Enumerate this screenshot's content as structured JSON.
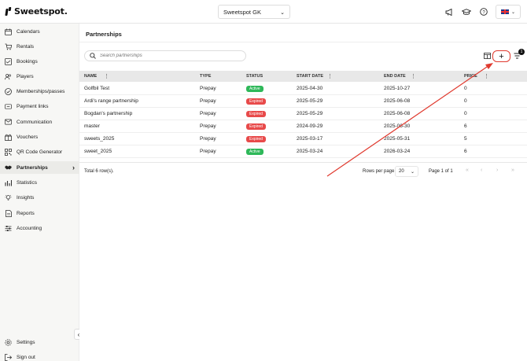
{
  "app": {
    "logo_text": "Sweetspot."
  },
  "header": {
    "club_select": "Sweetspot GK",
    "icons": [
      "megaphone-icon",
      "graduation-cap-icon",
      "help-icon"
    ],
    "language": "english"
  },
  "sidebar": {
    "items": [
      {
        "label": "Calendars",
        "icon": "calendar-icon"
      },
      {
        "label": "Rentals",
        "icon": "cart-icon"
      },
      {
        "label": "Bookings",
        "icon": "bookings-icon"
      },
      {
        "label": "Players",
        "icon": "players-icon"
      },
      {
        "label": "Memberships/passes",
        "icon": "check-circle-icon"
      },
      {
        "label": "Payment links",
        "icon": "link-icon"
      },
      {
        "label": "Communication",
        "icon": "mail-icon"
      },
      {
        "label": "Vouchers",
        "icon": "gift-icon"
      },
      {
        "label": "QR Code Generator",
        "icon": "qr-icon"
      },
      {
        "label": "Partnerships",
        "icon": "handshake-icon",
        "active": true
      },
      {
        "label": "Statistics",
        "icon": "chart-icon"
      },
      {
        "label": "Insights",
        "icon": "lightbulb-icon"
      },
      {
        "label": "Reports",
        "icon": "report-icon"
      },
      {
        "label": "Accounting",
        "icon": "sliders-icon"
      }
    ],
    "bottom": [
      {
        "label": "Settings",
        "icon": "gear-icon"
      },
      {
        "label": "Sign out",
        "icon": "sign-out-icon"
      }
    ]
  },
  "main": {
    "title": "Partnerships",
    "search": {
      "placeholder": "Search partnerships",
      "value": ""
    },
    "toolbar": {
      "add_label": "+",
      "filter_count": "1"
    },
    "table": {
      "columns": [
        "NAME",
        "TYPE",
        "STATUS",
        "START DATE",
        "END DATE",
        "PRICE"
      ],
      "rows": [
        {
          "name": "Golfbil Test",
          "type": "Prepay",
          "status": "Active",
          "start": "2025-04-30",
          "end": "2025-10-27",
          "price": "0"
        },
        {
          "name": "Ardi's range partnership",
          "type": "Prepay",
          "status": "Expired",
          "start": "2025-05-29",
          "end": "2025-06-08",
          "price": "0"
        },
        {
          "name": "Bogdan's partnership",
          "type": "Prepay",
          "status": "Expired",
          "start": "2025-05-29",
          "end": "2025-06-08",
          "price": "0"
        },
        {
          "name": "master",
          "type": "Prepay",
          "status": "Expired",
          "start": "2024-09-29",
          "end": "2025-06-30",
          "price": "6"
        },
        {
          "name": "sweets_2025",
          "type": "Prepay",
          "status": "Expired",
          "start": "2025-03-17",
          "end": "2025-05-31",
          "price": "5"
        },
        {
          "name": "sweet_2025",
          "type": "Prepay",
          "status": "Active",
          "start": "2025-03-24",
          "end": "2026-03-24",
          "price": "6"
        }
      ]
    },
    "footer": {
      "total": "Total 6 row(s).",
      "rows_per_page_label": "Rows per page",
      "rows_per_page": "20",
      "page_of": "Page 1 of 1"
    }
  },
  "colors": {
    "accent_arrow": "#e03a2f",
    "active": "#2eb859",
    "expired": "#e84a4a"
  }
}
